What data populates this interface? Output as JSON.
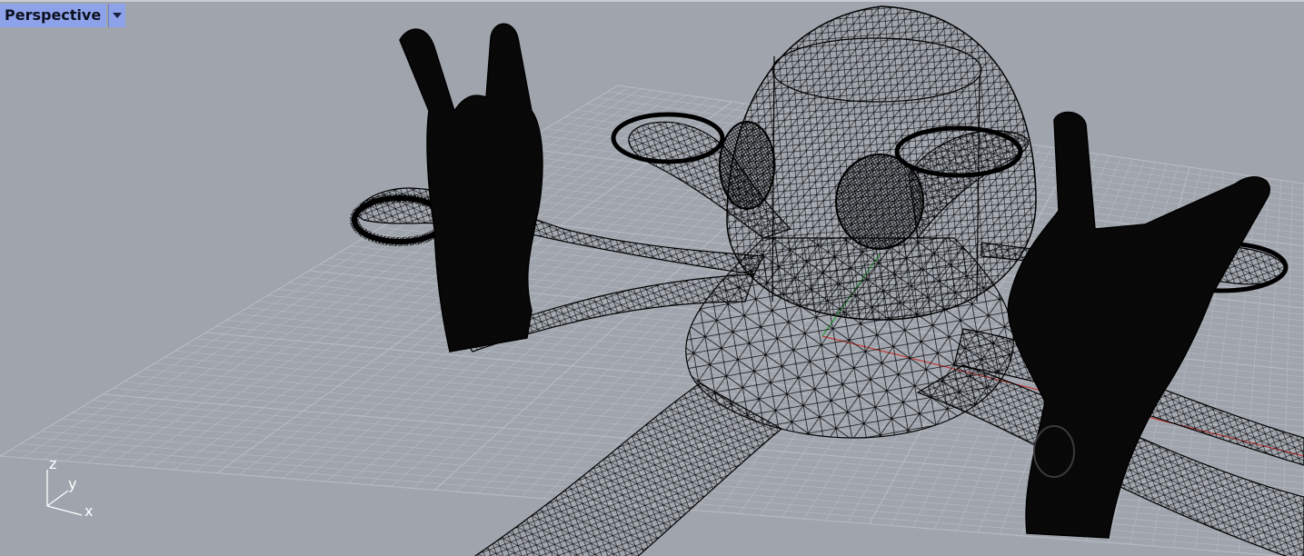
{
  "viewport": {
    "title": "Perspective",
    "menu_icon": "dropdown-triangle-icon",
    "background_color": "#a0a5ad",
    "grid_color": "#b7bcc3",
    "grid_major_color": "#8d939b",
    "wire_color": "#000000",
    "x_axis_color": "#c23b3b",
    "y_axis_color": "#2e9a3a"
  },
  "axis_widget": {
    "z_label": "z",
    "y_label": "y",
    "x_label": "x"
  }
}
